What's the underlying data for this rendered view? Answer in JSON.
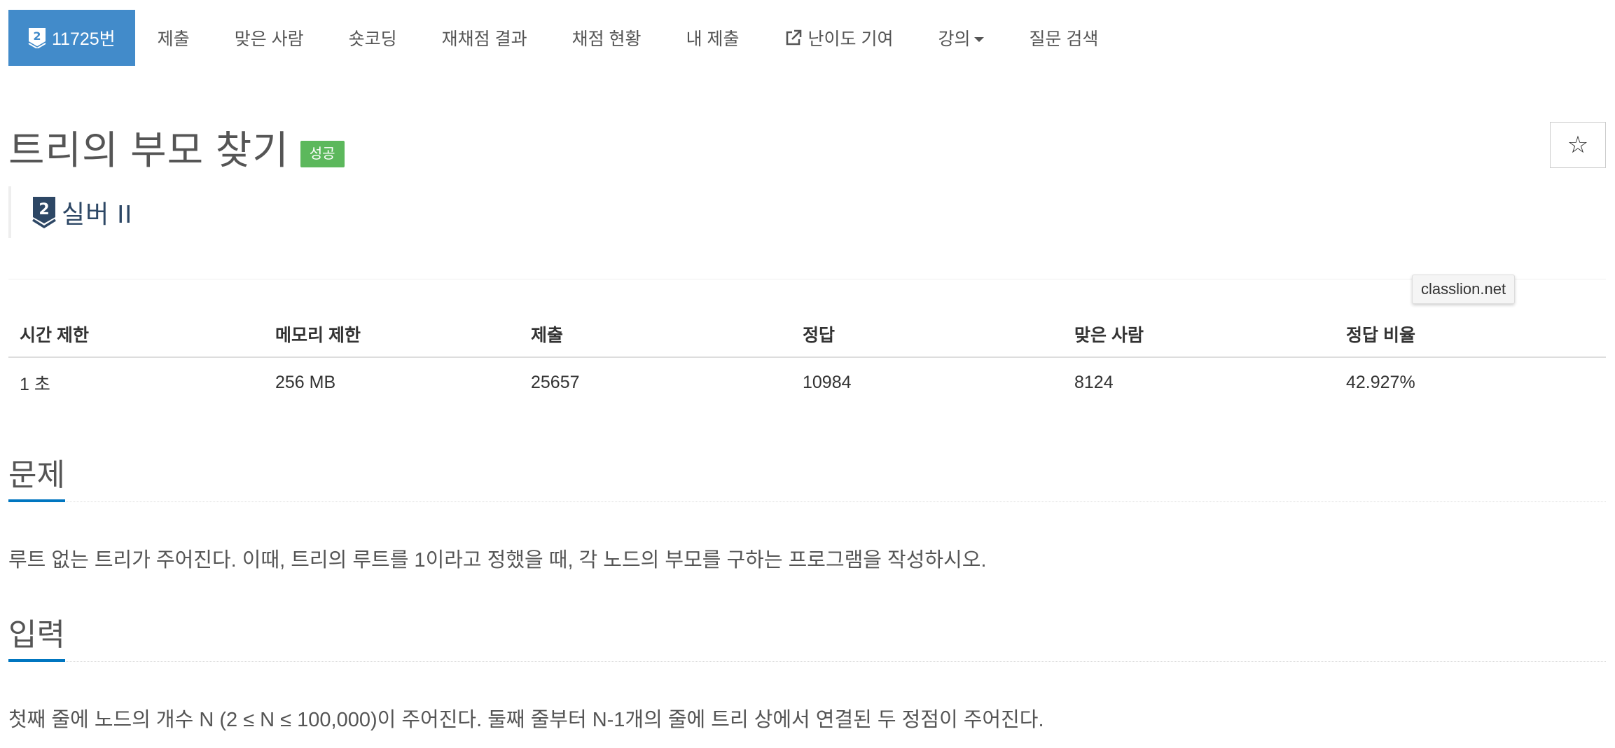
{
  "nav": {
    "problem": {
      "tier_number": "2",
      "label": "11725번"
    },
    "items": [
      {
        "key": "submit",
        "label": "제출"
      },
      {
        "key": "solved",
        "label": "맞은 사람"
      },
      {
        "key": "shortcoding",
        "label": "숏코딩"
      },
      {
        "key": "rejudge",
        "label": "재채점 결과"
      },
      {
        "key": "status",
        "label": "채점 현황"
      },
      {
        "key": "mysubmit",
        "label": "내 제출"
      }
    ],
    "difficulty_contribution": "난이도 기여",
    "lecture": "강의",
    "question_search": "질문 검색"
  },
  "problem": {
    "title": "트리의 부모 찾기",
    "result_badge": "성공",
    "tier": {
      "number": "2",
      "label": "실버 II",
      "color": "#2d4765"
    },
    "star": "☆"
  },
  "tooltip": "classlion.net",
  "stats": {
    "headers": [
      "시간 제한",
      "메모리 제한",
      "제출",
      "정답",
      "맞은 사람",
      "정답 비율"
    ],
    "values": [
      "1 초",
      "256 MB",
      "25657",
      "10984",
      "8124",
      "42.927%"
    ]
  },
  "sections": {
    "problem": {
      "title": "문제",
      "text": "루트 없는 트리가 주어진다. 이때, 트리의 루트를 1이라고 정했을 때, 각 노드의 부모를 구하는 프로그램을 작성하시오."
    },
    "input": {
      "title": "입력",
      "text": "첫째 줄에 노드의 개수 N (2 ≤ N ≤ 100,000)이 주어진다. 둘째 줄부터 N-1개의 줄에 트리 상에서 연결된 두 정점이 주어진다."
    }
  },
  "colors": {
    "accent": "#428bca",
    "success": "#5cb85c",
    "section_underline": "#0076c0"
  }
}
